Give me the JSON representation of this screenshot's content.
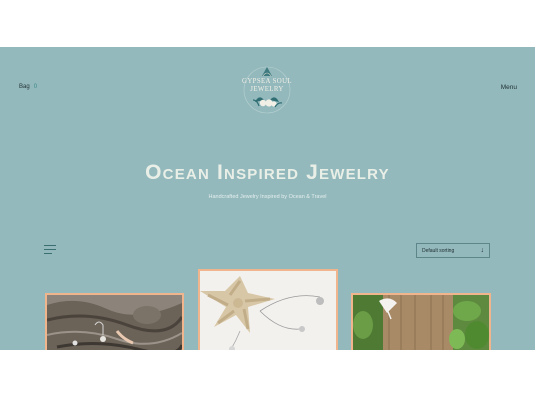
{
  "header": {
    "bag_label": "Bag",
    "bag_count": "0",
    "menu_label": "Menu",
    "logo_line1": "GYPSEA SOUL",
    "logo_line2": "JEWELRY"
  },
  "hero": {
    "title": "Ocean Inspired Jewelry",
    "subtitle": "Handcrafted Jewelry Inspired by Ocean & Travel"
  },
  "shop": {
    "sort_label": "Default sorting",
    "sort_icon": "arrow-down-icon",
    "filter_icon": "filter-lines-icon"
  },
  "colors": {
    "hero_bg": "#93b9bd",
    "title": "#e9efe7",
    "accent": "#3d8a86",
    "card_border": "#f1b58e"
  }
}
